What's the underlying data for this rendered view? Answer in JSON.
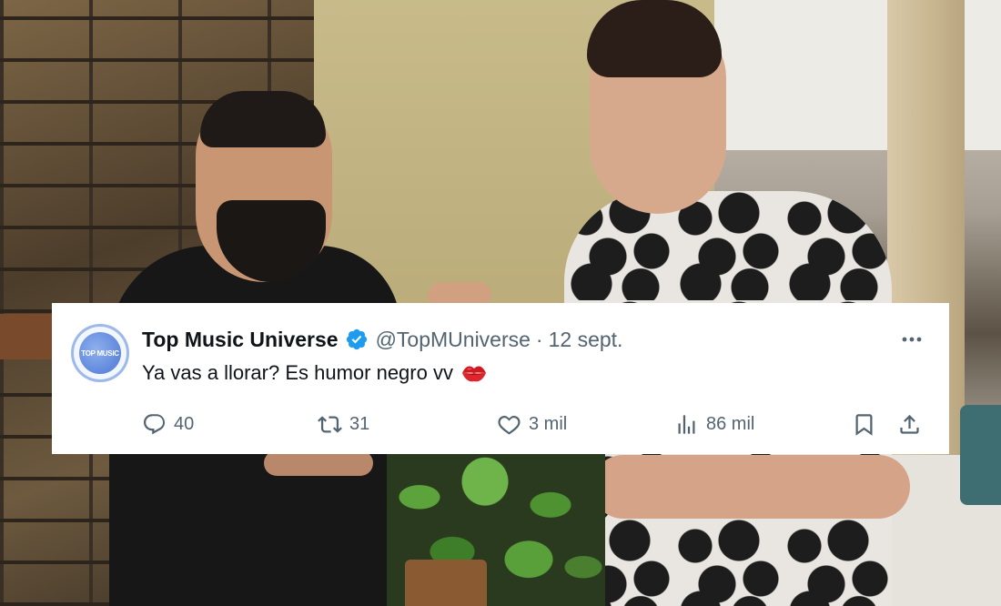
{
  "tweet": {
    "display_name": "Top Music Universe",
    "handle": "@TopMUniverse",
    "separator": "·",
    "date": "12 sept.",
    "text": "Ya vas a llorar? Es humor negro vv",
    "avatar_text": "TOP MUSIC",
    "verified": true,
    "emoji": "kiss-mark",
    "stats": {
      "replies": "40",
      "retweets": "31",
      "likes": "3 mil",
      "views": "86 mil"
    }
  },
  "colors": {
    "text_primary": "#0f1419",
    "text_secondary": "#536471",
    "verified_blue": "#1d9bf0",
    "card_background": "#ffffff"
  },
  "icons": [
    "reply-icon",
    "retweet-icon",
    "like-icon",
    "views-icon",
    "bookmark-icon",
    "share-icon",
    "more-icon",
    "verified-icon"
  ]
}
